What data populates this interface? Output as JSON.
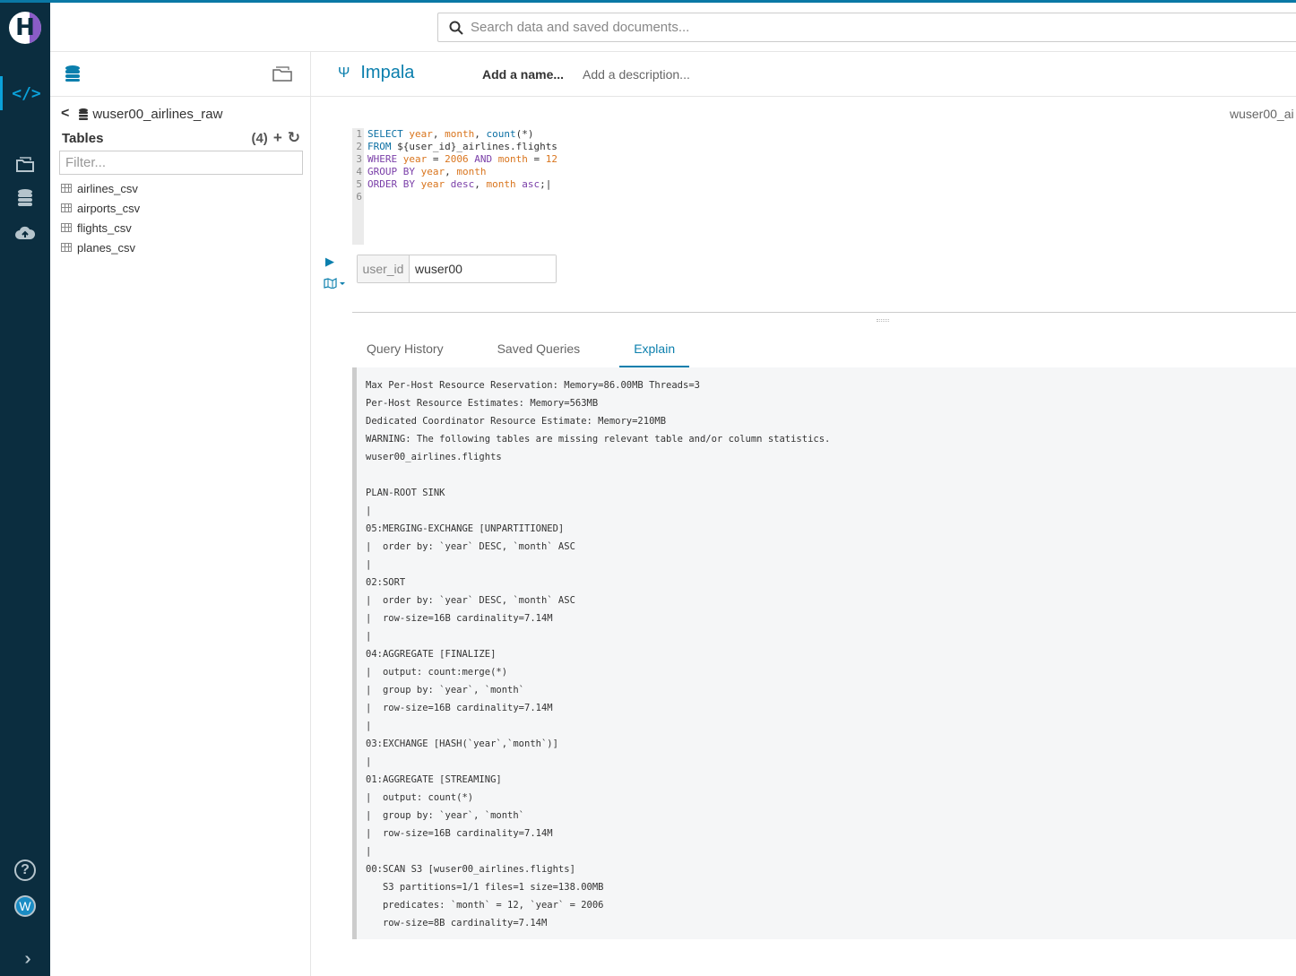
{
  "search": {
    "placeholder": "Search data and saved documents..."
  },
  "assist": {
    "database": "wuser00_airlines_raw",
    "tables_label": "Tables",
    "tables_count": "(4)",
    "filter_placeholder": "Filter...",
    "tables": [
      "airlines_csv",
      "airports_csv",
      "flights_csv",
      "planes_csv"
    ]
  },
  "editor": {
    "engine": "Impala",
    "name_placeholder": "Add a name...",
    "description_placeholder": "Add a description...",
    "database": "wuser00_ai",
    "line_numbers": [
      "1",
      "2",
      "3",
      "4",
      "5",
      "6"
    ],
    "param_label": "user_id",
    "param_value": "wuser00"
  },
  "tabs": [
    "Query History",
    "Saved Queries",
    "Explain"
  ],
  "active_tab": "Explain",
  "explain_text": "Max Per-Host Resource Reservation: Memory=86.00MB Threads=3\nPer-Host Resource Estimates: Memory=563MB\nDedicated Coordinator Resource Estimate: Memory=210MB\nWARNING: The following tables are missing relevant table and/or column statistics.\nwuser00_airlines.flights\n\nPLAN-ROOT SINK\n|\n05:MERGING-EXCHANGE [UNPARTITIONED]\n|  order by: `year` DESC, `month` ASC\n|\n02:SORT\n|  order by: `year` DESC, `month` ASC\n|  row-size=16B cardinality=7.14M\n|\n04:AGGREGATE [FINALIZE]\n|  output: count:merge(*)\n|  group by: `year`, `month`\n|  row-size=16B cardinality=7.14M\n|\n03:EXCHANGE [HASH(`year`,`month`)]\n|\n01:AGGREGATE [STREAMING]\n|  output: count(*)\n|  group by: `year`, `month`\n|  row-size=16B cardinality=7.14M\n|\n00:SCAN S3 [wuser00_airlines.flights]\n   S3 partitions=1/1 files=1 size=138.00MB\n   predicates: `month` = 12, `year` = 2006\n   row-size=8B cardinality=7.14M",
  "nav": {
    "avatar_letter": "W",
    "help_symbol": "?"
  },
  "colors": {
    "nav_bg": "#0b2d3f",
    "accent": "#0b7fad",
    "explain_bg": "#f5f6f7"
  }
}
